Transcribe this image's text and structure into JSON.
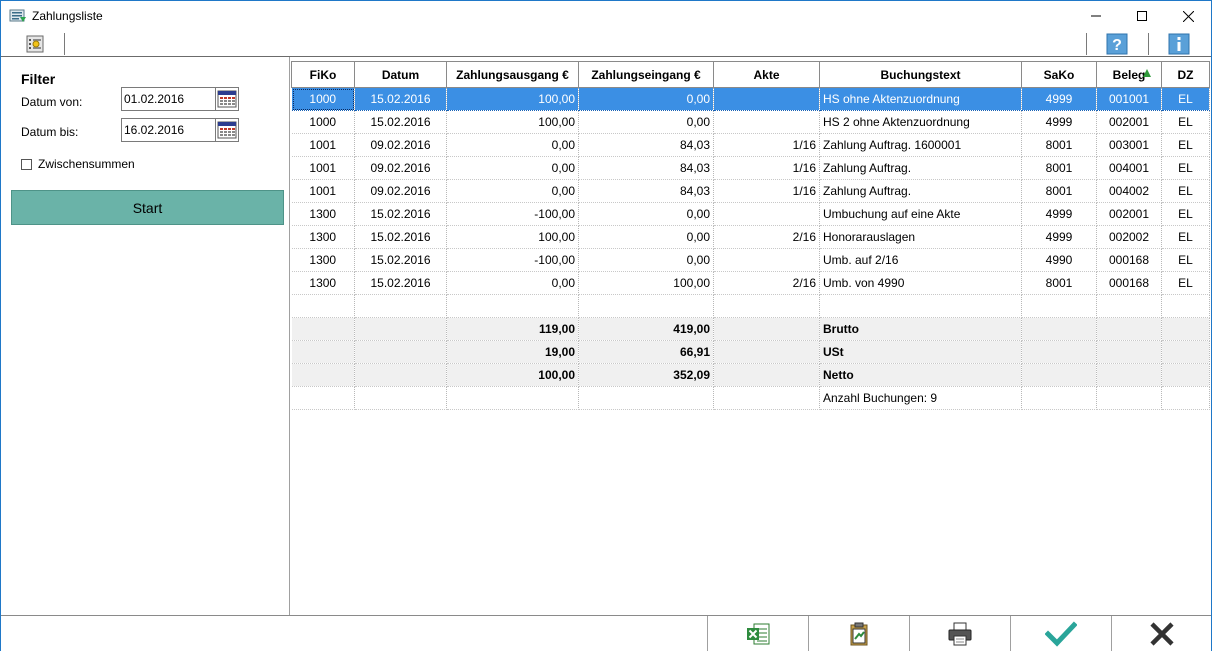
{
  "window": {
    "title": "Zahlungsliste"
  },
  "filter": {
    "title": "Filter",
    "datum_von_label": "Datum von:",
    "datum_von_value": "01.02.2016",
    "datum_bis_label": "Datum bis:",
    "datum_bis_value": "16.02.2016",
    "zwischensummen_label": "Zwischensummen",
    "zwischensummen_checked": false,
    "start_label": "Start"
  },
  "table": {
    "columns": [
      "FiKo",
      "Datum",
      "Zahlungsausgang €",
      "Zahlungseingang €",
      "Akte",
      "Buchungstext",
      "SaKo",
      "Beleg",
      "DZ"
    ],
    "sort_column": "Beleg",
    "rows": [
      [
        "1000",
        "15.02.2016",
        "100,00",
        "0,00",
        "",
        "HS ohne Aktenzuordnung",
        "4999",
        "001001",
        "EL"
      ],
      [
        "1000",
        "15.02.2016",
        "100,00",
        "0,00",
        "",
        "HS 2 ohne Aktenzuordnung",
        "4999",
        "002001",
        "EL"
      ],
      [
        "1001",
        "09.02.2016",
        "0,00",
        "84,03",
        "1/16",
        "Zahlung Auftrag. 1600001",
        "8001",
        "003001",
        "EL"
      ],
      [
        "1001",
        "09.02.2016",
        "0,00",
        "84,03",
        "1/16",
        "Zahlung Auftrag.",
        "8001",
        "004001",
        "EL"
      ],
      [
        "1001",
        "09.02.2016",
        "0,00",
        "84,03",
        "1/16",
        "Zahlung Auftrag.",
        "8001",
        "004002",
        "EL"
      ],
      [
        "1300",
        "15.02.2016",
        "-100,00",
        "0,00",
        "",
        "Umbuchung auf eine Akte",
        "4999",
        "002001",
        "EL"
      ],
      [
        "1300",
        "15.02.2016",
        "100,00",
        "0,00",
        "2/16",
        "Honorarauslagen",
        "4999",
        "002002",
        "EL"
      ],
      [
        "1300",
        "15.02.2016",
        "-100,00",
        "0,00",
        "",
        "Umb. auf 2/16",
        "4990",
        "000168",
        "EL"
      ],
      [
        "1300",
        "15.02.2016",
        "0,00",
        "100,00",
        "2/16",
        "Umb. von 4990",
        "8001",
        "000168",
        "EL"
      ]
    ],
    "summary": [
      {
        "ausgang": "119,00",
        "eingang": "419,00",
        "label": "Brutto"
      },
      {
        "ausgang": "19,00",
        "eingang": "66,91",
        "label": "USt"
      },
      {
        "ausgang": "100,00",
        "eingang": "352,09",
        "label": "Netto"
      }
    ],
    "count_text": "Anzahl Buchungen: 9"
  },
  "colors": {
    "selection": "#3b8fe4",
    "start_button": "#6ab3a8",
    "window_border": "#1f78c8",
    "accent_green": "#2aa59a"
  }
}
